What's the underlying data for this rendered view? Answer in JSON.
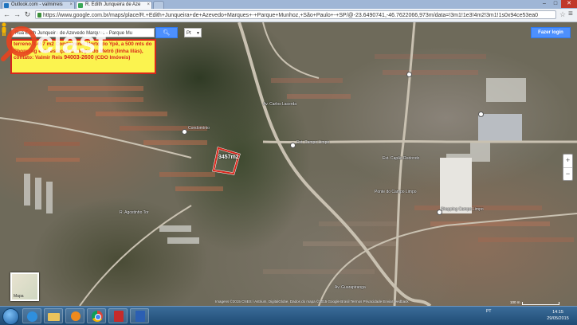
{
  "browser": {
    "tabs": [
      {
        "title": "Outlook.com - valmirreis",
        "active": false
      },
      {
        "title": "R. Edith Junqueira de Aze",
        "active": true
      }
    ],
    "url": "https://www.google.com.br/maps/place/R.+Edith+Junqueira+de+Azevedo+Marques+-+Parque+Munhoz,+São+Paulo+-+SP/@-23.6490741,-46.7622066,973m/data=!3m1!1e3!4m2!3m1!1s0x94ce53ea0"
  },
  "maps": {
    "search_value": "Rua Edith Junqueira de Azevedo Marques - Parque Mu",
    "search_button_icon": "search-icon",
    "layer_select": "Pt",
    "signin_label": "Fazer login",
    "info_text": "terreno 3.457 m2 Condomínio Horto do Ypê, a 500 mts do Shopping e da estação C.Limpo do Metrô (linha lilás), contato: Valmir Reis",
    "info_phone": "94003-2600",
    "info_suffix": "(CDO Imóveis)",
    "plot_label": "3457m2",
    "place_labels": [
      "Condomínio",
      "Est. Campo Limpo",
      "Est. Capão Redondo",
      "Shopping Campo Limpo",
      "Ponte do Campo Limpo",
      "R. Agostinho Tor",
      "Av. Carlos Lacerda",
      "Av. Guarapiranga"
    ],
    "minimap_label": "Mapa",
    "attribution": "Imagens ©2015 CNES / Astrium, DigitalGlobe, Dados do mapa ©2015 Google   Brasil   Termos   Privacidade   Enviar feedback",
    "scale_label": "100 m"
  },
  "watermark": {
    "text": "clasf",
    "color": "#ffffff",
    "accent": "#e8431e"
  },
  "taskbar": {
    "clock_time": "14:15",
    "clock_date": "29/05/2015",
    "tray_lang": "PT"
  },
  "colors": {
    "highlight_border": "#d8261b",
    "info_bg": "#fbf34f",
    "google_blue": "#4d90fe"
  }
}
